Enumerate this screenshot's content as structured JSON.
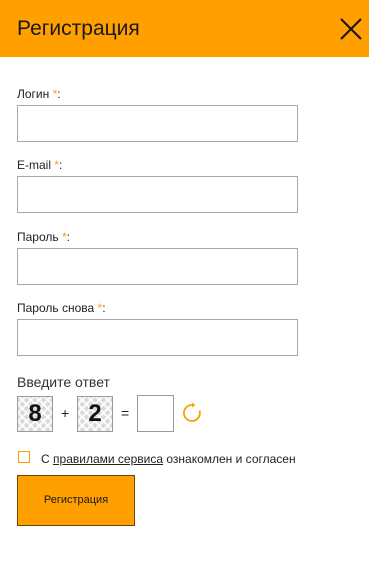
{
  "header": {
    "title": "Регистрация",
    "close_icon": "close-icon"
  },
  "form": {
    "login": {
      "label": "Логин",
      "required_mark": "*",
      "colon": ":",
      "value": ""
    },
    "email": {
      "label": "E-mail",
      "required_mark": "*",
      "colon": ":",
      "value": ""
    },
    "password": {
      "label": "Пароль",
      "required_mark": "*",
      "colon": ":",
      "value": ""
    },
    "password_repeat": {
      "label": "Пароль снова",
      "required_mark": "*",
      "colon": ":",
      "value": ""
    }
  },
  "captcha": {
    "label": "Введите ответ",
    "operand_a": "8",
    "operator": "+",
    "operand_b": "2",
    "equals": "=",
    "answer": "",
    "refresh_icon": "refresh-icon"
  },
  "agreement": {
    "prefix": "С",
    "link": "правилами сервиса",
    "suffix": "ознакомлен и согласен",
    "checked": false
  },
  "submit": {
    "label": "Регистрация"
  },
  "colors": {
    "accent": "#ff9f00",
    "text": "#1a1a1a",
    "input_border": "#a8a8a8"
  }
}
